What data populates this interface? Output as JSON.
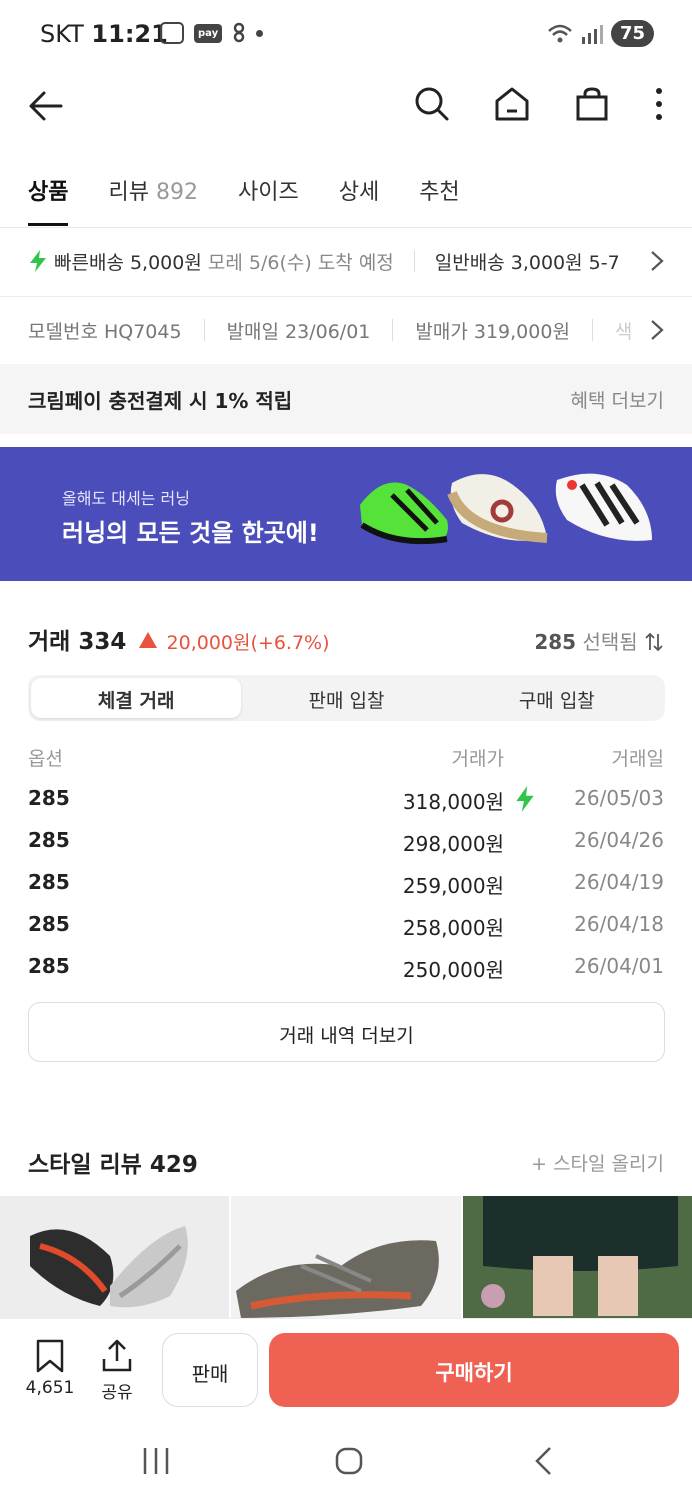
{
  "status": {
    "carrier": "SKT",
    "time": "11:21",
    "pay_label": "pay",
    "battery": "75"
  },
  "tabs": [
    {
      "label": "상품",
      "count": ""
    },
    {
      "label": "리뷰",
      "count": "892"
    },
    {
      "label": "사이즈",
      "count": ""
    },
    {
      "label": "상세",
      "count": ""
    },
    {
      "label": "추천",
      "count": ""
    }
  ],
  "shipping": {
    "fast_label": "빠른배송 5,000원",
    "fast_eta": "모레 5/6(수) 도착 예정",
    "normal_label": "일반배송 3,000원 5-7"
  },
  "model": {
    "model_no": "모델번호 HQ7045",
    "release_date": "발매일 23/06/01",
    "release_price": "발매가 319,000원",
    "extra": "색"
  },
  "benefit": {
    "text": "크림페이 충전결제 시 1% 적립",
    "more": "혜택 더보기"
  },
  "banner": {
    "subtitle": "올해도 대세는 러닝",
    "title": "러닝의 모든 것을 한곳에!"
  },
  "trades": {
    "title": "거래 334",
    "change": "20,000원(+6.7%)",
    "selected_size": "285",
    "selected_label": "선택됨",
    "segments": [
      "체결 거래",
      "판매 입찰",
      "구매 입찰"
    ],
    "columns": [
      "옵션",
      "거래가",
      "거래일"
    ],
    "rows": [
      {
        "option": "285",
        "price": "318,000원",
        "date": "26/05/03",
        "fast": true
      },
      {
        "option": "285",
        "price": "298,000원",
        "date": "26/04/26",
        "fast": false
      },
      {
        "option": "285",
        "price": "259,000원",
        "date": "26/04/19",
        "fast": false
      },
      {
        "option": "285",
        "price": "258,000원",
        "date": "26/04/18",
        "fast": false
      },
      {
        "option": "285",
        "price": "250,000원",
        "date": "26/04/01",
        "fast": false
      }
    ],
    "more_button": "거래 내역 더보기"
  },
  "style_review": {
    "title": "스타일 리뷰 429",
    "upload": "+ 스타일 올리기"
  },
  "bottom": {
    "bookmark_count": "4,651",
    "share": "공유",
    "sell": "판매",
    "buy": "구매하기"
  },
  "colors": {
    "accent_red": "#ef6253",
    "banner": "#4a4dba",
    "fast_green": "#31c54a"
  }
}
